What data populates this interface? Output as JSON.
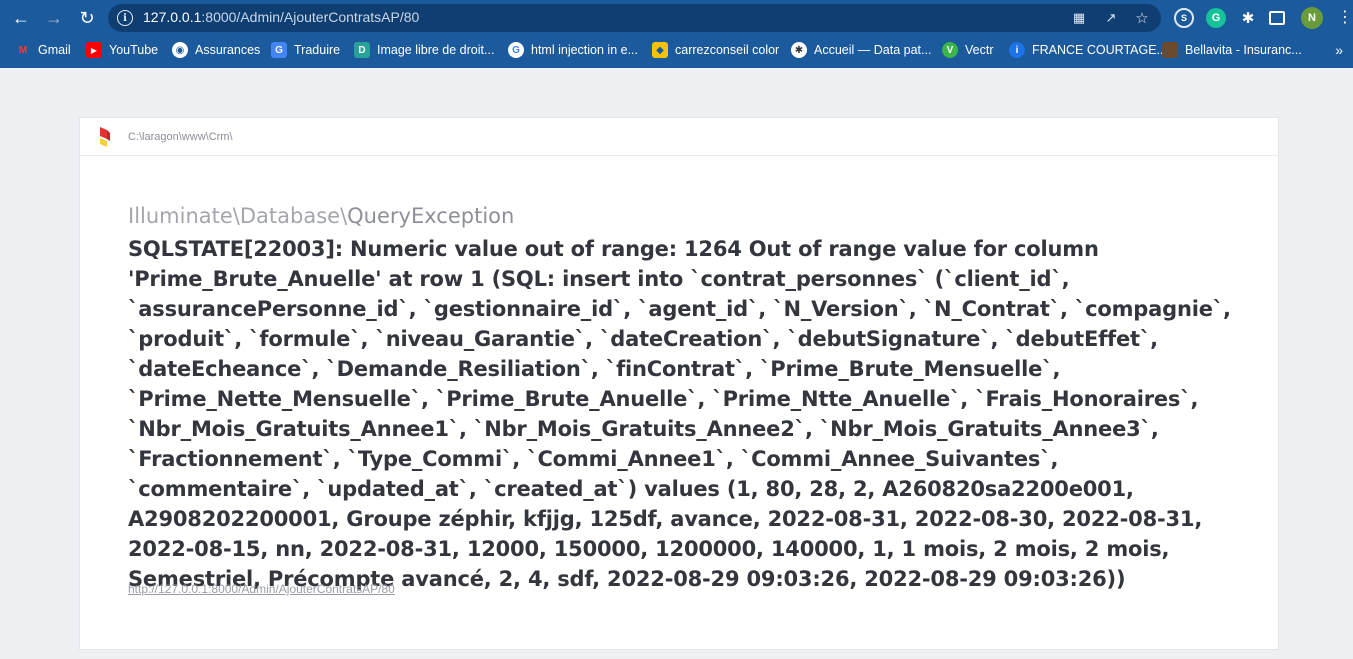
{
  "browser": {
    "url_host": "127.0.0.1",
    "url_rest": ":8000/Admin/AjouterContratsAP/80",
    "profile_initial": "N",
    "grammarly_initial": "G"
  },
  "bookmarks": [
    {
      "label": "Gmail",
      "icon": "gmail-icon",
      "color": "#ea4335",
      "glyph": "M"
    },
    {
      "label": "YouTube",
      "icon": "youtube-icon",
      "color": "#ff0000",
      "glyph": "▶"
    },
    {
      "label": "Assurances",
      "icon": "globe-icon",
      "color": "#ffffff",
      "glyph": "●"
    },
    {
      "label": "Traduire",
      "icon": "translate-icon",
      "color": "#4285f4",
      "glyph": "G"
    },
    {
      "label": "Image libre de droit...",
      "icon": "image-icon",
      "color": "#2aa198",
      "glyph": "D"
    },
    {
      "label": "html injection in e...",
      "icon": "google-icon",
      "color": "#ffffff",
      "glyph": "G"
    },
    {
      "label": "carrezconseil color",
      "icon": "palette-icon",
      "color": "#f4c20d",
      "glyph": "◆"
    },
    {
      "label": "Accueil — Data pat...",
      "icon": "data-icon",
      "color": "#ffffff",
      "glyph": "✱"
    },
    {
      "label": "Vectr",
      "icon": "vectr-icon",
      "color": "#39b54a",
      "glyph": "V"
    },
    {
      "label": "FRANCE COURTAGE...",
      "icon": "info-icon",
      "color": "#1a73e8",
      "glyph": "i"
    },
    {
      "label": "Bellavita - Insuranc...",
      "icon": "bellavita-icon",
      "color": "#6b4a2e",
      "glyph": "▮"
    }
  ],
  "page": {
    "path": "C:\\laragon\\www\\Crm\\",
    "exception_ns": "Illuminate\\Database\\",
    "exception_name": "QueryException",
    "message": "SQLSTATE[22003]: Numeric value out of range: 1264 Out of range value for column 'Prime_Brute_Anuelle' at row 1 (SQL: insert into `contrat_personnes` (`client_id`, `assurancePersonne_id`, `gestionnaire_id`, `agent_id`, `N_Version`, `N_Contrat`, `compagnie`, `produit`, `formule`, `niveau_Garantie`, `dateCreation`, `debutSignature`, `debutEffet`, `dateEcheance`, `Demande_Resiliation`, `finContrat`, `Prime_Brute_Mensuelle`, `Prime_Nette_Mensuelle`, `Prime_Brute_Anuelle`, `Prime_Ntte_Anuelle`, `Frais_Honoraires`, `Nbr_Mois_Gratuits_Annee1`, `Nbr_Mois_Gratuits_Annee2`, `Nbr_Mois_Gratuits_Annee3`, `Fractionnement`, `Type_Commi`, `Commi_Annee1`, `Commi_Annee_Suivantes`, `commentaire`, `updated_at`, `created_at`) values (1, 80, 28, 2, A260820sa2200e001, A2908202200001, Groupe zéphir, kfjjg, 125df, avance, 2022-08-31, 2022-08-30, 2022-08-31, 2022-08-15, nn, 2022-08-31, 12000, 150000, 1200000, 140000, 1, 1 mois, 2 mois, 2 mois, Semestriel, Précompte avancé, 2, 4, sdf, 2022-08-29 09:03:26, 2022-08-29 09:03:26))",
    "request_url": "http://127.0.0.1:8000/Admin/AjouterContratsAP/80"
  }
}
